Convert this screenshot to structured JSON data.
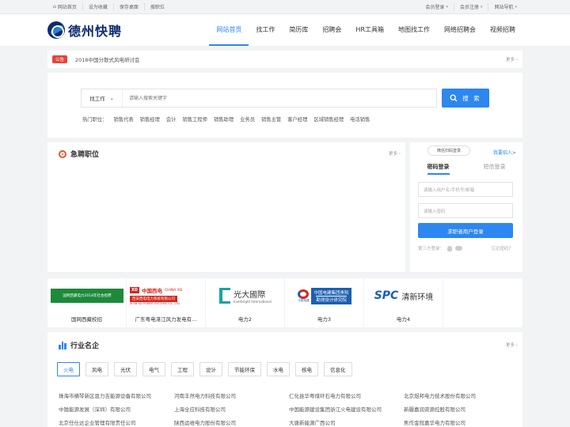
{
  "topbar": {
    "left": [
      "网站首页",
      "设为收藏",
      "保存桌面",
      "搜职位"
    ],
    "right": [
      "会员登录",
      "会员注册",
      "网站导航"
    ]
  },
  "header": {
    "logo_text": "德州快聘",
    "nav": [
      "网站首页",
      "找工作",
      "简历库",
      "招聘会",
      "HR工具箱",
      "地图找工作",
      "网络招聘会",
      "视频招聘"
    ],
    "active": 0
  },
  "notice": {
    "badge": "公告",
    "text": "2018中国分散式风电研讨会",
    "more": "更多"
  },
  "search": {
    "select_label": "找工作",
    "placeholder": "请输入搜索关键字",
    "button": "搜 索",
    "hot_label": "热门职位：",
    "hot": [
      "销售代表",
      "销售经理",
      "会计",
      "销售工程师",
      "销售助理",
      "业务员",
      "销售主管",
      "客户经理",
      "区域销售经理",
      "电话销售"
    ]
  },
  "urgent": {
    "title": "急聘职位",
    "more": "更多"
  },
  "login": {
    "qr": "微信扫码登录",
    "hire": "我要招人>",
    "tabs": [
      "密码登录",
      "短信登录"
    ],
    "user_placeholder": "请输入用户名/手机号/邮箱",
    "pass_placeholder": "请输入密码",
    "button": "求职者用户登录",
    "third": "第三方登录：",
    "forgot": "忘记密码？"
  },
  "logos": [
    {
      "img_text": "国网西藏电力2018年社会招聘",
      "caption": "国网西藏校招"
    },
    {
      "img_text": "中国西电",
      "img_sub": "CHINA XD",
      "img_line": "西安西电电力系统有限公司",
      "img_line2": "XI'AN XD POWER SYSTEMS CO., LTD.",
      "caption": "广东粤电湛江风力发电有..."
    },
    {
      "img_text": "光大國際",
      "img_sub": "Everbright International",
      "caption": "电力2"
    },
    {
      "img_text": "中国电建集团贵阳",
      "img_sub": "勘测设计研究院",
      "img_logo": "中国电建",
      "caption": "电力3"
    },
    {
      "img_text": "SPC",
      "img_sub": "清新环境",
      "caption": "电力4"
    }
  ],
  "industry": {
    "title": "行业名企",
    "more": "更多",
    "tags": [
      "火电",
      "风电",
      "光伏",
      "电气",
      "工程",
      "设计",
      "节能环保",
      "水电",
      "核电",
      "信息化"
    ],
    "active_tag": 0,
    "companies": [
      [
        "珠海市横琴新区恩力吉能源设备有限公司",
        "河南丰然电力科技有限公司",
        "仁化县华粤煤矸石电力有限公司",
        "北京煜邦电力技术股份有限公司"
      ],
      [
        "中陇能源发展（深圳）有限公司",
        "上海全应科技有限公司",
        "中国能源建设集团浙江火电建设有限公司",
        "新疆嘉润资源控股有限公司"
      ],
      [
        "北京任仕达企业管理有限责任公司",
        "陕西运维电力股份有限公司",
        "大唐新能源广西公司",
        "焦作金冠嘉华电力有限公司"
      ]
    ]
  },
  "colors": {
    "accent": "#2c87f0",
    "badge": "#e8433a",
    "brand": "#0f2c6e"
  }
}
